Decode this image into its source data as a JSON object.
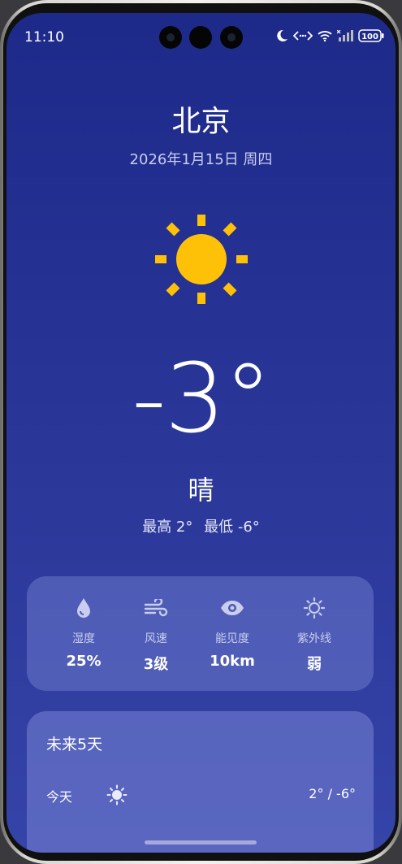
{
  "status_bar": {
    "time": "11:10",
    "battery": "100"
  },
  "weather": {
    "city": "北京",
    "date": "2026年1月15日 周四",
    "temperature": "-3°",
    "condition": "晴",
    "high": "最高 2°",
    "low": "最低 -6°"
  },
  "stats": [
    {
      "label": "湿度",
      "value": "25%",
      "icon": "humidity-drop-icon"
    },
    {
      "label": "风速",
      "value": "3级",
      "icon": "wind-icon"
    },
    {
      "label": "能见度",
      "value": "10km",
      "icon": "eye-icon"
    },
    {
      "label": "紫外线",
      "value": "弱",
      "icon": "uv-sun-icon"
    }
  ],
  "forecast": {
    "title": "未来5天",
    "days": [
      {
        "day": "今天",
        "icon": "sun-icon",
        "temps": "2° / -6°"
      }
    ]
  },
  "colors": {
    "accent_sun": "#FFC107",
    "background_top": "#1e2a8a",
    "card": "#5b66c0"
  }
}
